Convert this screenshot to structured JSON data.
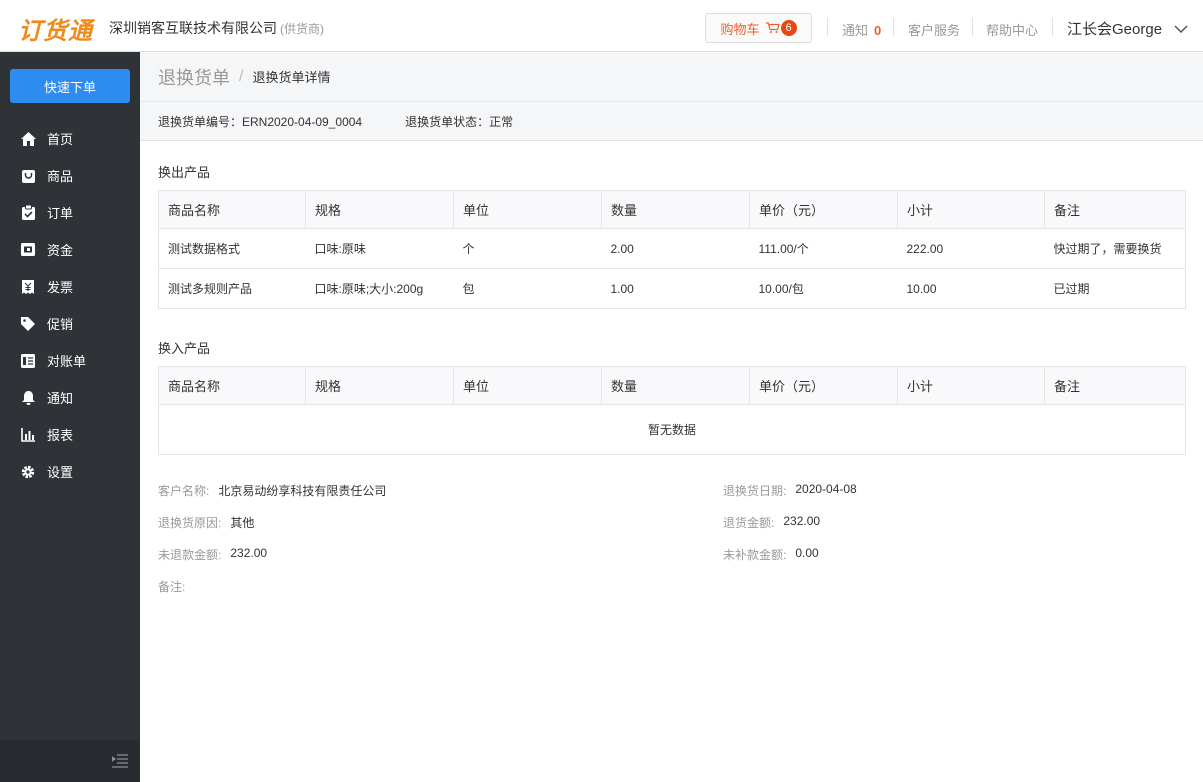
{
  "header": {
    "logo": "订货通",
    "company": "深圳销客互联技术有限公司",
    "role": "(供货商)",
    "cart_label": "购物车",
    "cart_count": "6",
    "notify_label": "通知",
    "notify_count": "0",
    "service_label": "客户服务",
    "help_label": "帮助中心",
    "user_name": "江长会George"
  },
  "sidebar": {
    "quick_order": "快速下单",
    "items": [
      {
        "label": "首页",
        "icon": "home-icon"
      },
      {
        "label": "商品",
        "icon": "bag-icon"
      },
      {
        "label": "订单",
        "icon": "clipboard-icon"
      },
      {
        "label": "资金",
        "icon": "wallet-icon"
      },
      {
        "label": "发票",
        "icon": "invoice-icon"
      },
      {
        "label": "促销",
        "icon": "tag-icon"
      },
      {
        "label": "对账单",
        "icon": "statement-icon"
      },
      {
        "label": "通知",
        "icon": "bell-icon"
      },
      {
        "label": "报表",
        "icon": "chart-icon"
      },
      {
        "label": "设置",
        "icon": "gear-icon"
      }
    ]
  },
  "breadcrumb": {
    "root": "退换货单",
    "separator": "/",
    "current": "退换货单详情"
  },
  "info": {
    "number": "退换货单编号：ERN2020-04-09_0004",
    "status": "退换货单状态：正常"
  },
  "out_section": {
    "title": "换出产品",
    "headers": [
      "商品名称",
      "规格",
      "单位",
      "数量",
      "单价（元）",
      "小计",
      "备注"
    ],
    "rows": [
      [
        "测试数据格式",
        "口味:原味",
        "个",
        "2.00",
        "111.00/个",
        "222.00",
        "快过期了，需要换货"
      ],
      [
        "测试多规则产品",
        "口味:原味;大小:200g",
        "包",
        "1.00",
        "10.00/包",
        "10.00",
        "已过期"
      ]
    ]
  },
  "in_section": {
    "title": "换入产品",
    "headers": [
      "商品名称",
      "规格",
      "单位",
      "数量",
      "单价（元）",
      "小计",
      "备注"
    ],
    "empty_text": "暂无数据"
  },
  "details": {
    "customer_label": "客户名称:",
    "customer_value": "北京易动纷享科技有限责任公司",
    "date_label": "退换货日期:",
    "date_value": "2020-04-08",
    "reason_label": "退换货原因:",
    "reason_value": "其他",
    "amount_label": "退货金额:",
    "amount_value": "232.00",
    "unrefunded_label": "未退款金额:",
    "unrefunded_value": "232.00",
    "unpaid_label": "未补款金额:",
    "unpaid_value": "0.00",
    "remark_label": "备注:"
  }
}
